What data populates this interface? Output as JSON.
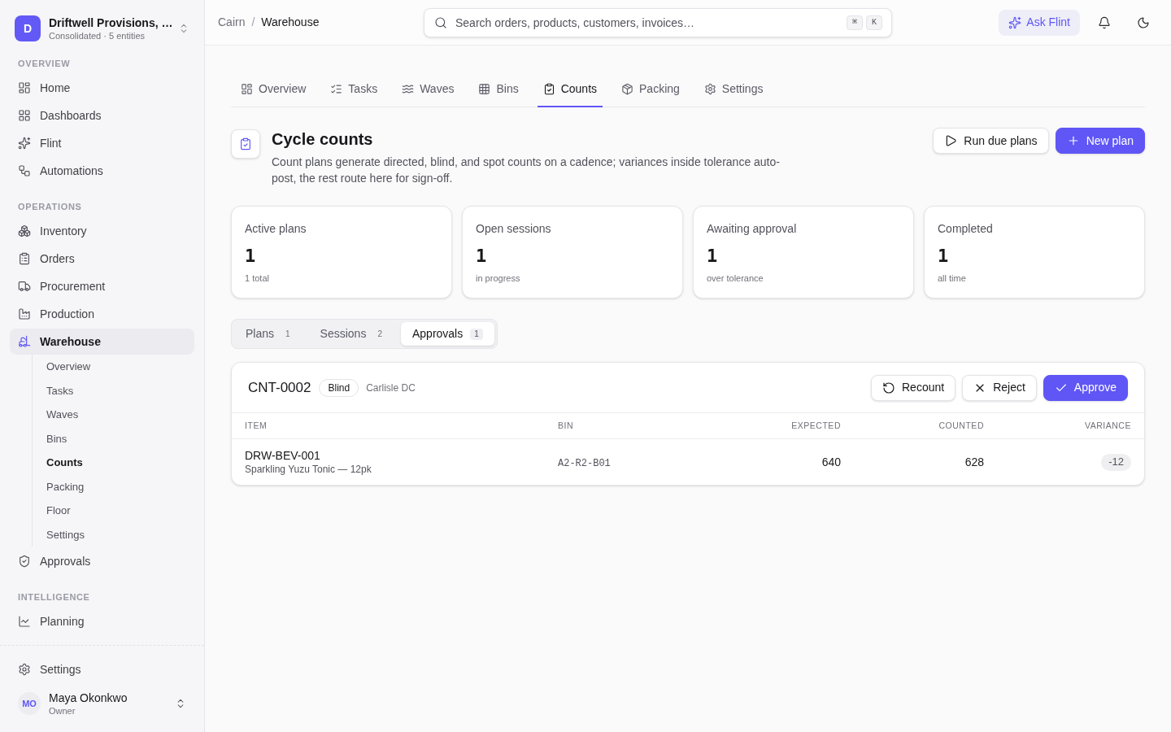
{
  "sidebar": {
    "org": {
      "initial": "D",
      "name": "Driftwell Provisions, …",
      "subtitle": "Consolidated · 5 entities"
    },
    "sections": [
      {
        "heading": "OVERVIEW",
        "items": [
          {
            "label": "Home",
            "selected": false
          },
          {
            "label": "Dashboards",
            "selected": false
          },
          {
            "label": "Flint",
            "selected": false
          },
          {
            "label": "Automations",
            "selected": false
          }
        ]
      },
      {
        "heading": "OPERATIONS",
        "items": [
          {
            "label": "Inventory",
            "selected": false
          },
          {
            "label": "Orders",
            "selected": false
          },
          {
            "label": "Procurement",
            "selected": false
          },
          {
            "label": "Production",
            "selected": false
          },
          {
            "label": "Warehouse",
            "selected": true,
            "children": [
              {
                "label": "Overview",
                "selected": false
              },
              {
                "label": "Tasks",
                "selected": false
              },
              {
                "label": "Waves",
                "selected": false
              },
              {
                "label": "Bins",
                "selected": false
              },
              {
                "label": "Counts",
                "selected": true
              },
              {
                "label": "Packing",
                "selected": false
              },
              {
                "label": "Floor",
                "selected": false
              },
              {
                "label": "Settings",
                "selected": false
              }
            ]
          },
          {
            "label": "Approvals",
            "selected": false
          }
        ]
      },
      {
        "heading": "INTELLIGENCE",
        "items": [
          {
            "label": "Planning",
            "selected": false
          }
        ]
      }
    ],
    "footer": {
      "settings": "Settings",
      "user": {
        "initials": "MO",
        "name": "Maya Okonkwo",
        "role": "Owner"
      }
    }
  },
  "header": {
    "breadcrumb": [
      "Cairn",
      "Warehouse"
    ],
    "separator": "/",
    "search": {
      "placeholder": "Search orders, products, customers, invoices…",
      "shortcut": [
        "⌘",
        "K"
      ]
    },
    "ask_button": "Ask Flint"
  },
  "tabs": [
    {
      "label": "Overview",
      "selected": false
    },
    {
      "label": "Tasks",
      "selected": false
    },
    {
      "label": "Waves",
      "selected": false
    },
    {
      "label": "Bins",
      "selected": false
    },
    {
      "label": "Counts",
      "selected": true
    },
    {
      "label": "Packing",
      "selected": false
    },
    {
      "label": "Settings",
      "selected": false
    }
  ],
  "page": {
    "title": "Cycle counts",
    "description": "Count plans generate directed, blind, and spot counts on a cadence; variances inside tolerance auto-post, the rest route here for sign-off.",
    "actions": [
      {
        "label": "Run due plans",
        "kind": "secondary"
      },
      {
        "label": "New plan",
        "kind": "primary"
      }
    ]
  },
  "stats": [
    {
      "label": "Active plans",
      "value": "1",
      "note": "1 total"
    },
    {
      "label": "Open sessions",
      "value": "1",
      "note": "in progress"
    },
    {
      "label": "Awaiting approval",
      "value": "1",
      "note": "over tolerance"
    },
    {
      "label": "Completed",
      "value": "1",
      "note": "all time"
    }
  ],
  "segments": [
    {
      "label": "Plans",
      "count": "1",
      "selected": false
    },
    {
      "label": "Sessions",
      "count": "2",
      "selected": false
    },
    {
      "label": "Approvals",
      "count": "1",
      "selected": true
    }
  ],
  "approval": {
    "id": "CNT-0002",
    "badge": "Blind",
    "location": "Carlisle DC",
    "actions": [
      {
        "label": "Recount",
        "kind": "secondary"
      },
      {
        "label": "Reject",
        "kind": "secondary"
      },
      {
        "label": "Approve",
        "kind": "primary"
      }
    ],
    "table": {
      "columns": [
        "ITEM",
        "BIN",
        "EXPECTED",
        "COUNTED",
        "VARIANCE"
      ],
      "rows": [
        {
          "sku": "DRW-BEV-001",
          "description": "Sparkling Yuzu Tonic — 12pk",
          "bin": "A2-R2-B01",
          "expected": "640",
          "counted": "628",
          "variance": "-12"
        }
      ]
    }
  }
}
